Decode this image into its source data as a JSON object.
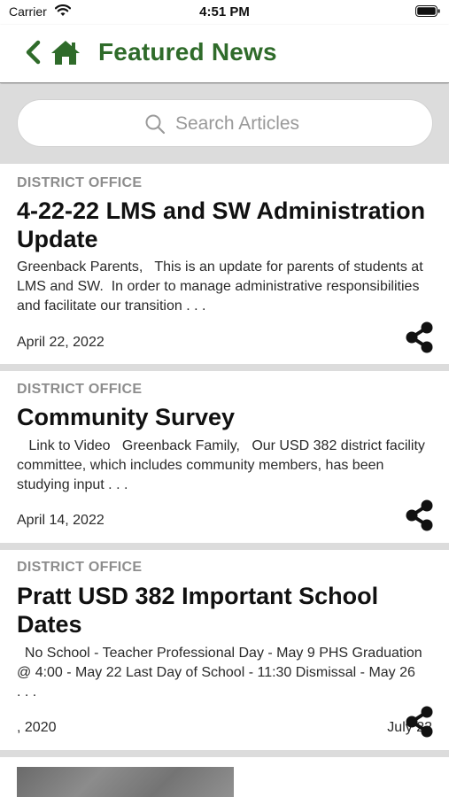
{
  "status_bar": {
    "carrier": "Carrier",
    "time": "4:51 PM"
  },
  "nav": {
    "title": "Featured News"
  },
  "search": {
    "placeholder": "Search Articles"
  },
  "articles": [
    {
      "category": "DISTRICT OFFICE",
      "title": "4-22-22 LMS and SW Administration Update",
      "excerpt": "Greenback Parents,   This is an update for parents of students at LMS and SW.  In order to manage administrative responsibilities and facilitate our transition . . .",
      "date": "April 22, 2022"
    },
    {
      "category": "DISTRICT OFFICE",
      "title": "Community Survey",
      "excerpt": "   Link to Video   Greenback Family,   Our USD 382 district facility committee, which includes community members, has been studying input . . .",
      "date": "April 14, 2022"
    },
    {
      "category": "DISTRICT OFFICE",
      "title": "Pratt USD 382 Important School Dates",
      "excerpt": "  No School - Teacher Professional Day - May 9 PHS Graduation @ 4:00 - May 22 Last Day of School - 11:30 Dismissal - May 26      . . .",
      "date": ", 2020",
      "date_right": "July 22"
    }
  ],
  "colors": {
    "accent": "#2f6b2a",
    "separator": "#dcdcdc",
    "category": "#8d8d8d"
  }
}
